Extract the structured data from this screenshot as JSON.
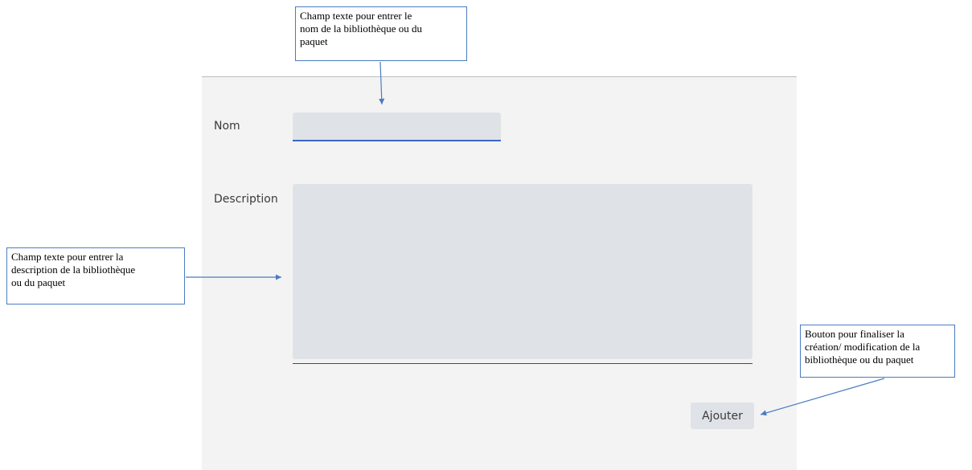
{
  "form": {
    "name_label": "Nom",
    "name_value": "",
    "description_label": "Description",
    "description_value": "",
    "submit_label": "Ajouter"
  },
  "annotations": {
    "name_field": "Champ texte pour entrer le\nnom de la bibliothèque ou du\npaquet",
    "description_field": "Champ texte pour entrer la\ndescription de la bibliothèque\nou du paquet",
    "submit_button": "Bouton pour finaliser la\ncréation/ modification de la\nbibliothèque ou du paquet"
  },
  "colors": {
    "panel_background": "#f3f3f3",
    "input_background": "#dfe3e7",
    "focus_underline": "#3b66c9",
    "callout_border": "#4a7cc0"
  }
}
